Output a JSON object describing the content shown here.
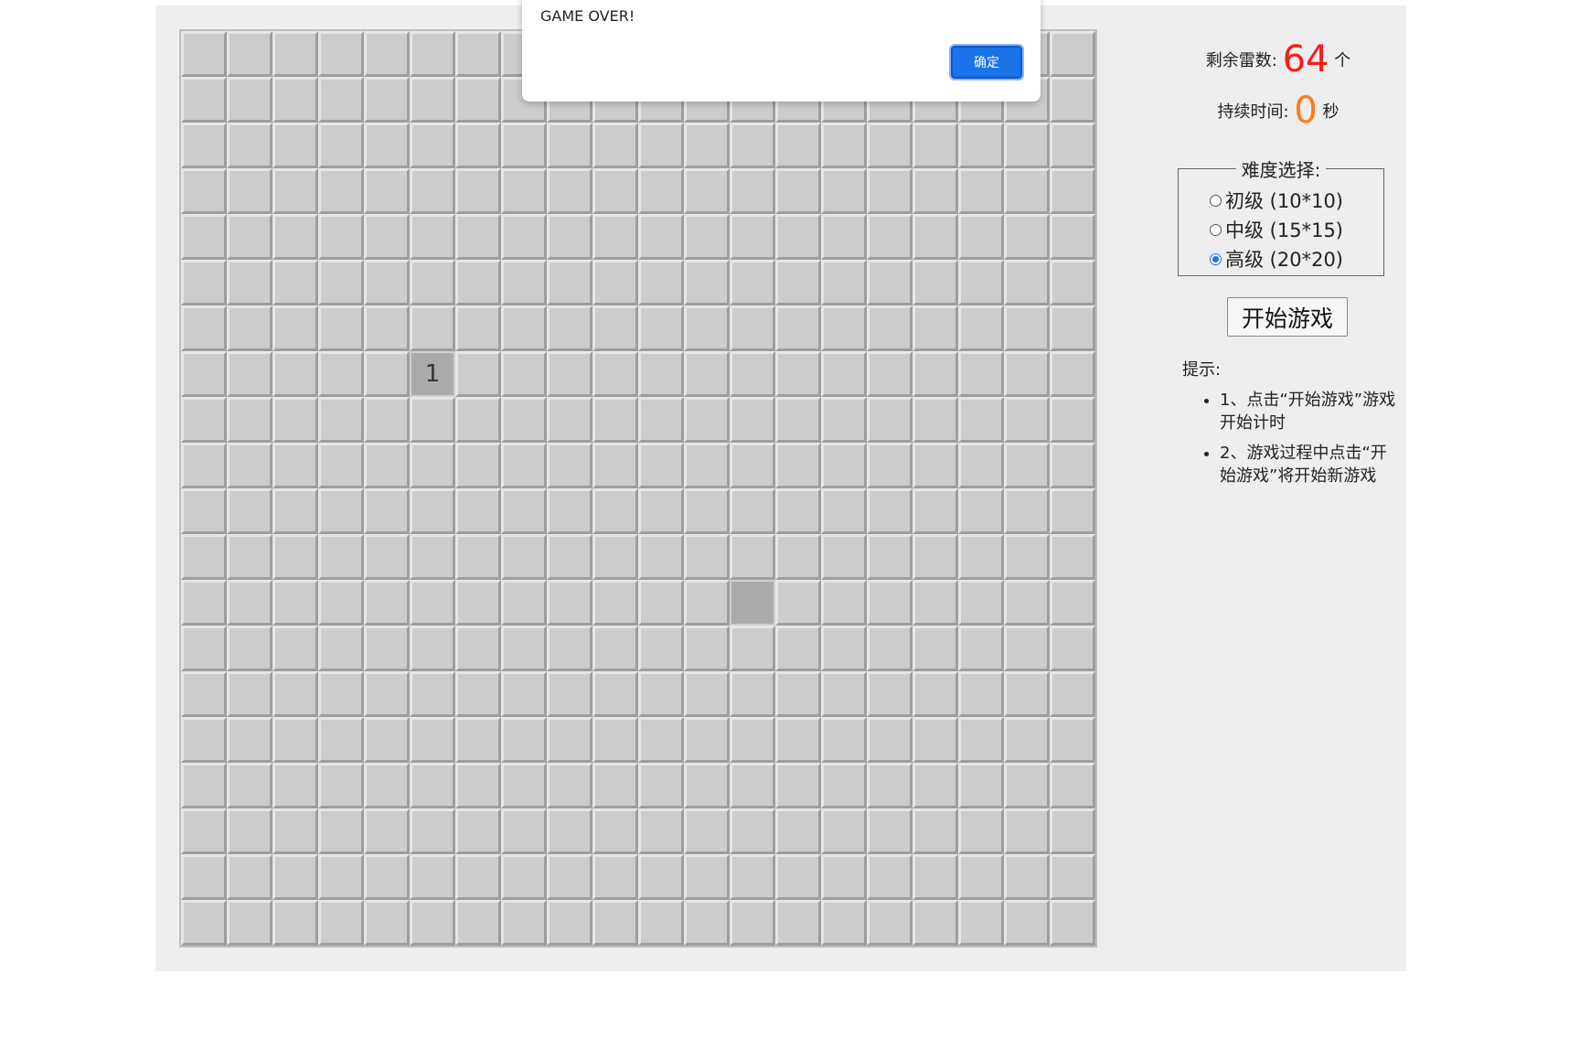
{
  "status": {
    "mines_label": "剩余雷数:",
    "mines_count": "64",
    "mines_unit": "个",
    "time_label": "持续时间:",
    "time_value": "0",
    "time_unit": "秒"
  },
  "difficulty": {
    "legend": "难度选择:",
    "options": [
      {
        "label": "初级 (10*10)",
        "checked": false
      },
      {
        "label": "中级 (15*15)",
        "checked": false
      },
      {
        "label": "高级 (20*20)",
        "checked": true
      }
    ]
  },
  "start_button": "开始游戏",
  "tips": {
    "title": "提示:",
    "items": [
      "1、点击“开始游戏”游戏开始计时",
      "2、游戏过程中点击“开始游戏”将开始新游戏"
    ]
  },
  "board": {
    "rows": 20,
    "cols": 20,
    "open_cells": [
      {
        "row": 7,
        "col": 5,
        "value": "1"
      },
      {
        "row": 12,
        "col": 12,
        "value": ""
      }
    ]
  },
  "dialog": {
    "message": "GAME OVER!",
    "ok_label": "确定"
  }
}
